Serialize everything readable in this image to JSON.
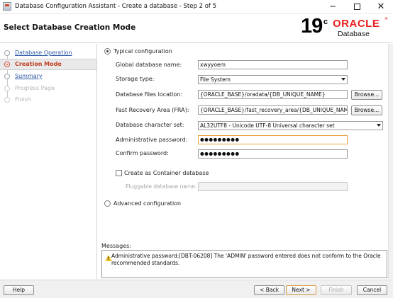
{
  "window": {
    "title": "Database Configuration Assistant - Create a database - Step 2 of 5",
    "minimize": "─",
    "close": "✕"
  },
  "header": {
    "page_title": "Select Database Creation Mode",
    "logo_version": "19",
    "logo_superscript": "c",
    "logo_brand": "ORACLE",
    "logo_registered": "®",
    "logo_product": "Database"
  },
  "nav": {
    "items": [
      {
        "label": "Database Operation",
        "state": "link"
      },
      {
        "label": "Creation Mode",
        "state": "current"
      },
      {
        "label": "Summary",
        "state": "link"
      },
      {
        "label": "Progress Page",
        "state": "disabled"
      },
      {
        "label": "Finish",
        "state": "disabled"
      }
    ]
  },
  "form": {
    "typical_label": "Typical configuration",
    "typical_selected": true,
    "global_db_name_label": "Global database name:",
    "global_db_name_value": "xwyyoem",
    "storage_type_label": "Storage type:",
    "storage_type_value": "File System",
    "db_files_location_label": "Database files location:",
    "db_files_location_value": "{ORACLE_BASE}/oradata/{DB_UNIQUE_NAME}",
    "fra_label": "Fast Recovery Area (FRA):",
    "fra_value": "{ORACLE_BASE}/fast_recovery_area/{DB_UNIQUE_NAME}",
    "browse_label": "Browse...",
    "charset_label": "Database character set:",
    "charset_value": "AL32UTF8 - Unicode UTF-8 Universal character set",
    "admin_password_label": "Administrative password:",
    "admin_password_value": "●●●●●●●●●",
    "confirm_password_label": "Confirm password:",
    "confirm_password_value": "●●●●●●●●●",
    "container_db_label": "Create as Container database",
    "container_db_checked": false,
    "pluggable_db_label": "Pluggable database name:",
    "pluggable_db_value": "",
    "advanced_label": "Advanced configuration",
    "advanced_selected": false
  },
  "messages": {
    "label": "Messages:",
    "text": "Administrative password:[DBT-06208] The 'ADMIN' password entered does not conform to the Oracle recommended standards.",
    "level": "warning"
  },
  "footer": {
    "help": "Help",
    "back": "< Back",
    "next": "Next >",
    "finish": "Finish",
    "cancel": "Cancel"
  },
  "colors": {
    "oracle_red": "#e8201f",
    "nav_link": "#2b58a8",
    "nav_current": "#c23c20",
    "focus_border": "#e6a33e",
    "warning": "#f2c530"
  }
}
